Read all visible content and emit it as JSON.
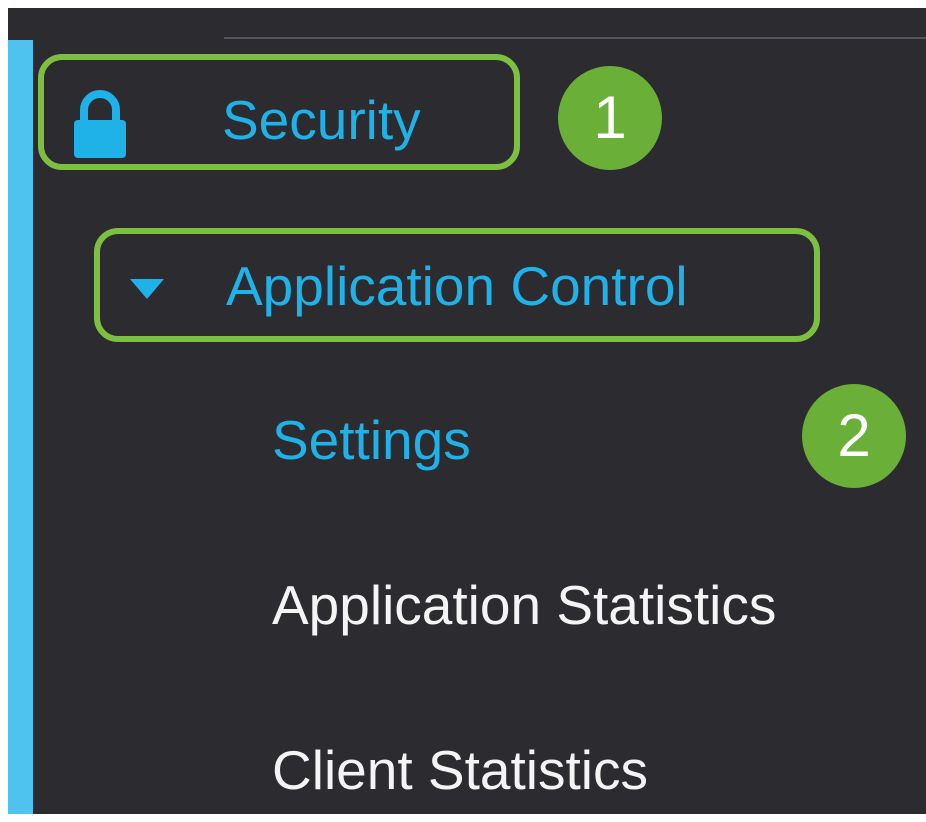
{
  "sidebar": {
    "security": {
      "label": "Security",
      "icon": "lock-icon",
      "color": "#1fb2e8"
    },
    "application_control": {
      "label": "Application Control",
      "icon": "caret-down-icon",
      "expanded": true,
      "color": "#1fb2e8",
      "children": [
        {
          "label": "Settings",
          "active": true,
          "color": "#1fb2e8"
        },
        {
          "label": "Application Statistics",
          "active": false,
          "color": "#f4f4f4"
        },
        {
          "label": "Client Statistics",
          "active": false,
          "color": "#f4f4f4"
        }
      ]
    }
  },
  "annotations": {
    "steps": [
      "1",
      "2"
    ],
    "highlight_color": "#7dc041",
    "badge_color": "#6aaf38"
  },
  "theme": {
    "background": "#2b2b30",
    "accent_bar": "#4fc3f0"
  }
}
